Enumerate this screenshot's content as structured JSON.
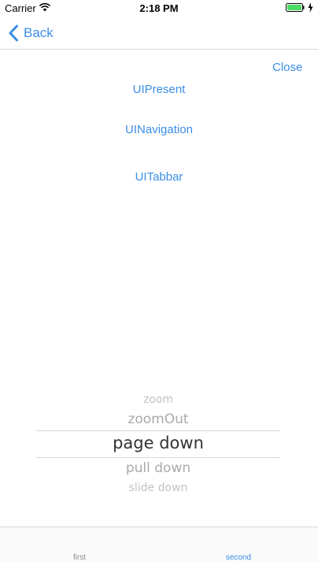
{
  "status_bar": {
    "carrier": "Carrier",
    "time": "2:18 PM",
    "battery_color": "#4cd964"
  },
  "nav": {
    "back_label": "Back",
    "accent_color": "#3a8ee6"
  },
  "close_label": "Close",
  "links": [
    {
      "label": "UIPresent"
    },
    {
      "label": "UINavigation"
    },
    {
      "label": "UITabbar"
    }
  ],
  "picker": {
    "items": [
      "zoom",
      "zoomOut",
      "page down",
      "pull down",
      "slide down"
    ],
    "selected": "page down"
  },
  "tabs": [
    {
      "label": "first",
      "selected": false
    },
    {
      "label": "second",
      "selected": true
    }
  ]
}
